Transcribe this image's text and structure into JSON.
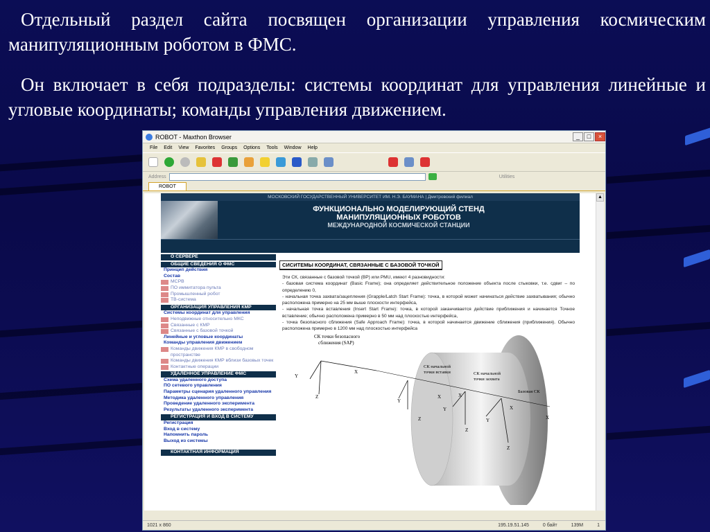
{
  "slide": {
    "para1": "Отдельный раздел сайта посвящен организации управления космическим манипуляционным роботом в ФМС.",
    "para2": "Он включает в себя подразделы: системы координат для управления линейные и угловые координаты; команды управления движением."
  },
  "browser": {
    "title": "ROBOT - Maxthon Browser",
    "menu": [
      "File",
      "Edit",
      "View",
      "Favorites",
      "Groups",
      "Options",
      "Tools",
      "Window",
      "Help"
    ],
    "address_label": "Address",
    "utilities_label": "Utilities",
    "tab": "ROBOT",
    "status_size": "1021 x 860",
    "status_ip": "195.19.51.145",
    "status_bytes": "0 байт",
    "status_mem": "139M",
    "status_page": "1"
  },
  "site": {
    "top_line": "МОСКОВСКИЙ ГОСУДАРСТВЕННЫЙ УНИВЕРСИТЕТ ИМ. Н.Э. БАУМАНА | Дмитровский филиал",
    "banner_l1": "ФУНКЦИОНАЛЬНО МОДЕЛИРУЮЩИЙ СТЕНД",
    "banner_l2": "МАНИПУЛЯЦИОННЫХ РОБОТОВ",
    "banner_l3": "МЕЖДУНАРОДНОЙ КОСМИЧЕСКОЙ СТАНЦИИ"
  },
  "nav": {
    "server": "О СЕРВЕРЕ",
    "general": "ОБЩИЕ СВЕДЕНИЯ О ФМС",
    "principle": "Принцип действия",
    "composition": "Состав",
    "mpv": "МСРВ",
    "pult": "ПО иммитатора пульта",
    "robot": "Промышленный робот",
    "tv": "ТВ-система",
    "org": "ОРГАНИЗАЦИЯ УПРАВЛЕНИЯ КМР",
    "coords": "Системы координат для управления",
    "coords_s1": "Неподвижные относительно МКС",
    "coords_s2": "Связанные с КМР",
    "coords_s3": "Связанные с базовой точкой",
    "lin": "Линейные и угловые координаты",
    "cmds": "Команды управления движением",
    "cmds_s1": "Команды движения КМР в свободном пространстве",
    "cmds_s2": "Команды движения КМР вблизи базовых точек",
    "cmds_s3": "Контактные операции",
    "remote": "УДАЛЕННОЕ УПРАВЛЕНИЕ ФМС",
    "r1": "Схема удаленного доступа",
    "r2": "ПО сетевого управления",
    "r3": "Параметры сценария удаленного управления",
    "r4": "Методика удаленного управления",
    "r5": "Проведение удаленного эксперимента",
    "r6": "Результаты удаленного эксперимента",
    "reg": "РЕГИСТРАЦИЯ И ВХОД В СИСТЕМУ",
    "g1": "Регистрация",
    "g2": "Вход в систему",
    "g3": "Напомнить пароль",
    "g4": "Выход из системы",
    "contact": "КОНТАКТНАЯ ИНФОРМАЦИЯ"
  },
  "content": {
    "title": "СИСИТЕМЫ КООРДИНАТ, СВЯЗАННЫЕ С БАЗОВОЙ ТОЧКОЙ",
    "intro": "Эти СК, связанные с базовой точкой (ВР) или PMU, имеют 4 разновидности:",
    "b1": "- базовая система координат (Basic Frame); она определяет действительное положение объекта после стыковки, т.е. сдвиг – по определению 0,",
    "b2": "- начальная точка захвата/зацепления (Grapple/Latch Start Frame): точка, в которой может начинаться действие захватывания; обычно расположена примерно на 25 мм выше плоскости интерфейса,",
    "b3": "- начальная точка вставления (Insert Start Frame): точка, в которой заканчивается действие приближения и начинается Точное вставление; обычно расположена примерно в 50 мм над плоскостью интерфейса,",
    "b4": "- точка безопасного сближения (Safe Approach Frame): точка, в которой начинается движение сближения (приближения). Обычно расположена примерно в 1200 мм над плоскостью интерфейса"
  },
  "diagram": {
    "sap_label_1": "СК точки безопасного",
    "sap_label_2": "сближения (SAP)",
    "insert_label_1": "СК начальной",
    "insert_label_2": "точки вставки",
    "grapple_label_1": "СК начальной",
    "grapple_label_2": "точки захвата",
    "base_label": "Базовая СК",
    "x": "X",
    "y": "Y",
    "z": "Z"
  }
}
